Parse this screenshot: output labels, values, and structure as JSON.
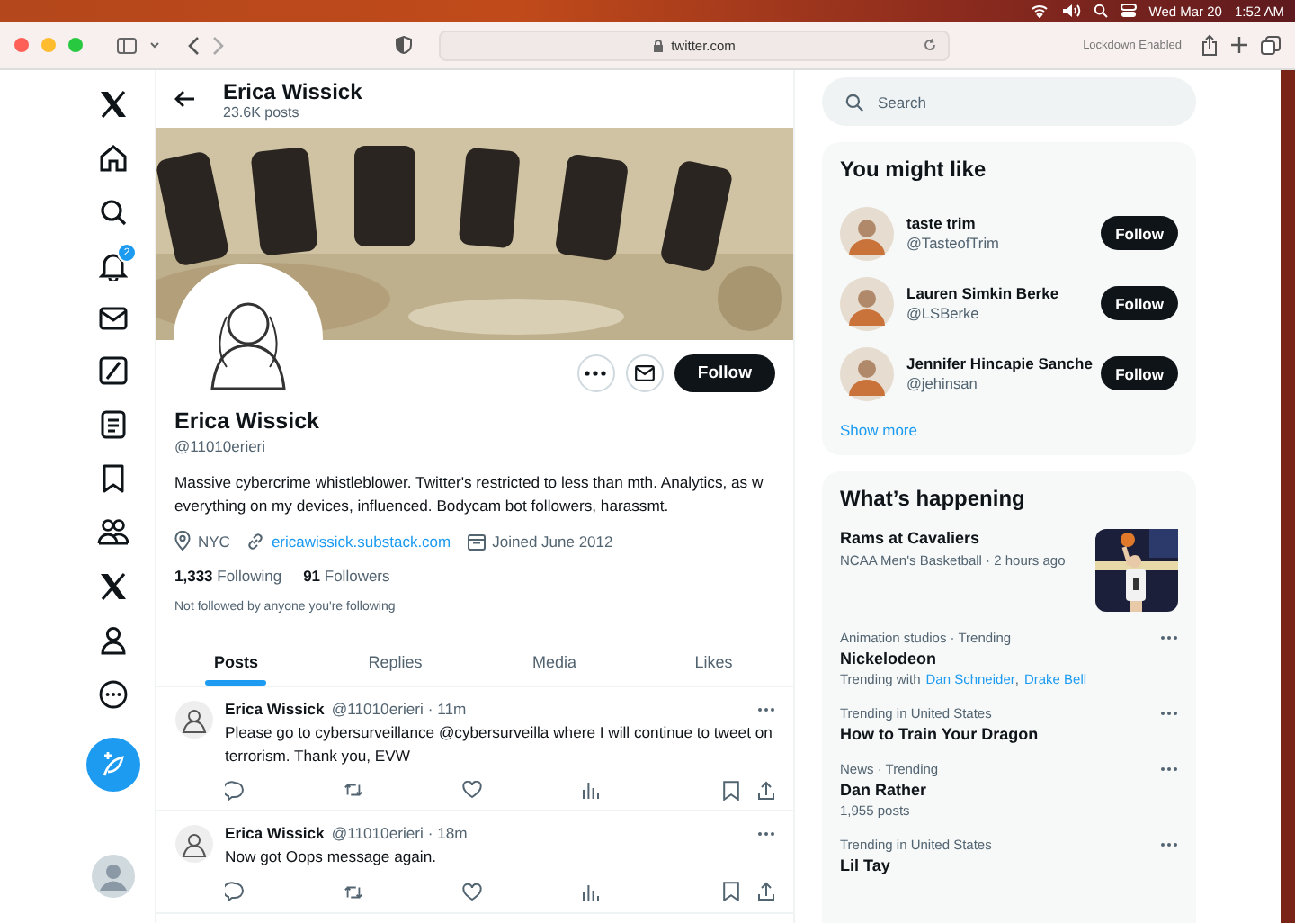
{
  "menubar": {
    "date": "Wed Mar 20",
    "time": "1:52 AM"
  },
  "browser": {
    "url": "twitter.com",
    "lockdown": "Lockdown Enabled"
  },
  "nav": {
    "notification_count": "2"
  },
  "header": {
    "name": "Erica Wissick"
  },
  "profile": {
    "name": "Erica Wissick",
    "posts": "23.6K posts",
    "handle": "@11010erieri",
    "follow_label": "Follow",
    "bio": "Massive cybercrime whistleblower. Twitter's restricted to less than mth. Analytics, as w everything on my devices, influenced. Bodycam bot followers, harassmt.",
    "location": "NYC",
    "link": "ericawissick.substack.com",
    "joined": "Joined June 2012",
    "following_count": "1,333",
    "following_label": "Following",
    "followers_count": "91",
    "followers_label": "Followers",
    "followed_by": "Not followed by anyone you're following"
  },
  "tabs": [
    {
      "label": "Posts",
      "selected": true
    },
    {
      "label": "Replies",
      "selected": false
    },
    {
      "label": "Media",
      "selected": false
    },
    {
      "label": "Likes",
      "selected": false
    }
  ],
  "posts": [
    {
      "name": "Erica Wissick",
      "handle_time": "@11010erieri · 11m",
      "text": "Please go to cybersurveillance @cybersurveilla where I will continue to tweet on terrorism. Thank you, EVW"
    },
    {
      "name": "Erica Wissick",
      "handle_time": "@11010erieri · 18m",
      "text": "Now got Oops message again."
    }
  ],
  "search": {
    "placeholder": "Search"
  },
  "suggestions": {
    "title": "You might like",
    "show_more": "Show more",
    "accounts": [
      {
        "name": "taste trim",
        "handle": "@TasteofTrim",
        "follow": "Follow"
      },
      {
        "name": "Lauren Simkin Berke",
        "handle": "@LSBerke",
        "follow": "Follow"
      },
      {
        "name": "Jennifer Hincapie Sanche",
        "handle": "@jehinsan",
        "follow": "Follow"
      }
    ]
  },
  "trends": {
    "title": "What’s happening",
    "items": [
      {
        "kind": "event",
        "title": "Rams at Cavaliers",
        "meta": "NCAA Men's Basketball · 2 hours ago"
      },
      {
        "kind": "trend",
        "context": "Animation studios · Trending",
        "title": "Nickelodeon",
        "related_prefix": "Trending with",
        "related": [
          {
            "name": "Dan Schneider",
            "sep": ","
          },
          {
            "name": "Drake Bell"
          }
        ]
      },
      {
        "kind": "trend",
        "context": "Trending in United States",
        "title": "How to Train Your Dragon"
      },
      {
        "kind": "trend",
        "context": "News · Trending",
        "title": "Dan Rather",
        "count": "1,955 posts"
      },
      {
        "kind": "trend",
        "context": "Trending in United States",
        "title": "Lil Tay"
      }
    ]
  }
}
